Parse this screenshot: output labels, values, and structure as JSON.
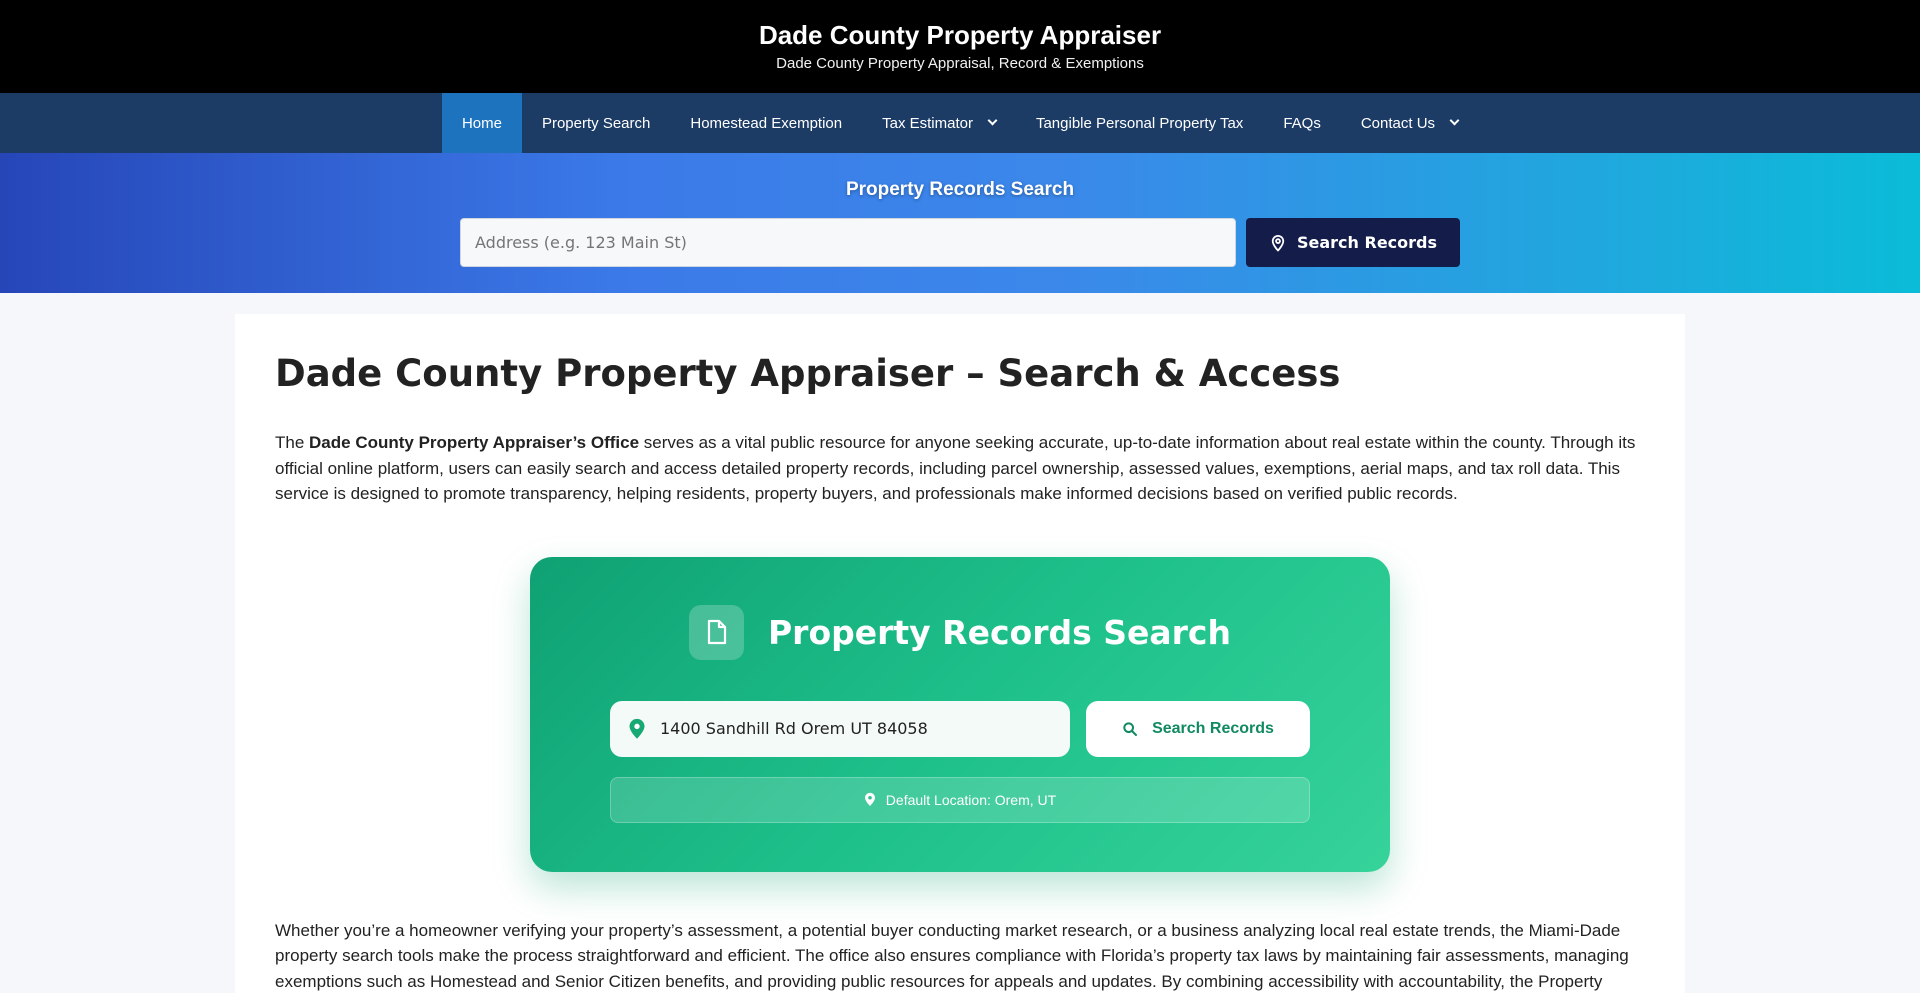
{
  "header": {
    "title": "Dade County Property Appraiser",
    "tagline": "Dade County Property Appraisal, Record & Exemptions"
  },
  "nav": {
    "items": [
      {
        "label": "Home",
        "active": true
      },
      {
        "label": "Property Search"
      },
      {
        "label": "Homestead Exemption"
      },
      {
        "label": "Tax Estimator",
        "has_dropdown": true
      },
      {
        "label": "Tangible Personal Property Tax"
      },
      {
        "label": "FAQs"
      },
      {
        "label": "Contact Us",
        "has_dropdown": true
      }
    ]
  },
  "hero": {
    "title": "Property Records Search",
    "placeholder": "Address (e.g. 123 Main St)",
    "button_label": "Search Records",
    "button_icon": "map-pin-outline-icon"
  },
  "main": {
    "title": "Dade County Property Appraiser – Search & Access",
    "intro_before": "The ",
    "intro_bold": "Dade County Property Appraiser’s Office",
    "intro_after": " serves as a vital public resource for anyone seeking accurate, up-to-date information about real estate within the county. Through its official online platform, users can easily search and access detailed property records, including parcel ownership, assessed values, exemptions, aerial maps, and tax roll data. This service is designed to promote transparency, helping residents, property buyers, and professionals make informed decisions based on verified public records.",
    "outro": "Whether you’re a homeowner verifying your property’s assessment, a potential buyer conducting market research, or a business analyzing local real estate trends, the Miami-Dade property search tools make the process straightforward and efficient. The office also ensures compliance with Florida’s property tax laws by maintaining fair assessments, managing exemptions such as Homestead and Senior Citizen benefits, and providing public resources for appeals and updates. By combining accessibility with accountability, the Property"
  },
  "card": {
    "title": "Property Records Search",
    "title_icon": "document-icon",
    "address_value": "1400 Sandhill Rd Orem UT 84058",
    "button_label": "Search Records",
    "default_location": "Default Location: Orem, UT"
  },
  "colors": {
    "header_bg": "#000000",
    "nav_bg": "#1c3c66",
    "nav_active": "#1e73be",
    "hero_button": "#141c4a",
    "card_green": "#1ec08a"
  }
}
